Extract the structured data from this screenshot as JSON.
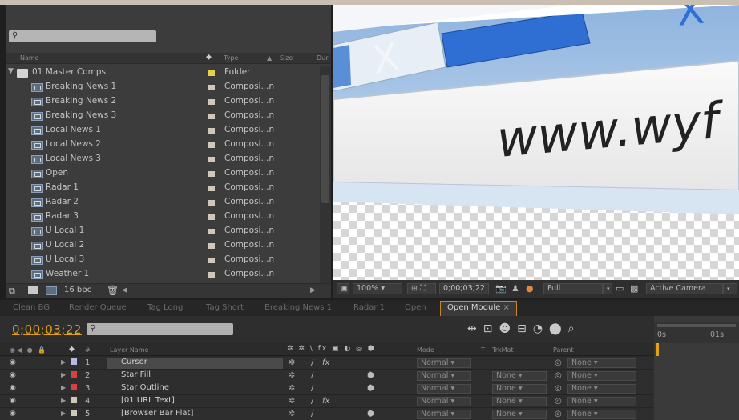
{
  "project": {
    "columns": {
      "name": "Name",
      "type": "Type",
      "size": "Size",
      "dur": "Dur"
    },
    "rows": [
      {
        "name": "01 Master Comps",
        "type": "Folder",
        "kind": "folder",
        "label_color": "#e2d24a"
      },
      {
        "name": "Breaking News 1",
        "type": "Composi...n",
        "kind": "comp",
        "label_color": "#cfc8b8"
      },
      {
        "name": "Breaking News 2",
        "type": "Composi...n",
        "kind": "comp",
        "label_color": "#cfc8b8"
      },
      {
        "name": "Breaking News 3",
        "type": "Composi...n",
        "kind": "comp",
        "label_color": "#cfc8b8"
      },
      {
        "name": "Local News 1",
        "type": "Composi...n",
        "kind": "comp",
        "label_color": "#cfc8b8"
      },
      {
        "name": "Local News 2",
        "type": "Composi...n",
        "kind": "comp",
        "label_color": "#cfc8b8"
      },
      {
        "name": "Local News 3",
        "type": "Composi...n",
        "kind": "comp",
        "label_color": "#cfc8b8"
      },
      {
        "name": "Open",
        "type": "Composi...n",
        "kind": "comp",
        "label_color": "#cfc8b8"
      },
      {
        "name": "Radar 1",
        "type": "Composi...n",
        "kind": "comp",
        "label_color": "#cfc8b8"
      },
      {
        "name": "Radar 2",
        "type": "Composi...n",
        "kind": "comp",
        "label_color": "#cfc8b8"
      },
      {
        "name": "Radar 3",
        "type": "Composi...n",
        "kind": "comp",
        "label_color": "#cfc8b8"
      },
      {
        "name": "U Local 1",
        "type": "Composi...n",
        "kind": "comp",
        "label_color": "#cfc8b8"
      },
      {
        "name": "U Local 2",
        "type": "Composi...n",
        "kind": "comp",
        "label_color": "#cfc8b8"
      },
      {
        "name": "U Local 3",
        "type": "Composi...n",
        "kind": "comp",
        "label_color": "#cfc8b8"
      },
      {
        "name": "Weather 1",
        "type": "Composi...n",
        "kind": "comp",
        "label_color": "#cfc8b8"
      }
    ],
    "bpc": "16 bpc"
  },
  "viewer": {
    "url_text": "www.wyf",
    "x_text": "X",
    "zoom": "100%",
    "timecode": "0;00;03;22",
    "resolution": "Full",
    "camera": "Active Camera"
  },
  "tabs": [
    {
      "label": "Clean BG",
      "active": false
    },
    {
      "label": "Render Queue",
      "active": false
    },
    {
      "label": "Tag Long",
      "active": false
    },
    {
      "label": "Tag Short",
      "active": false
    },
    {
      "label": "Breaking News 1",
      "active": false
    },
    {
      "label": "Radar 1",
      "active": false
    },
    {
      "label": "Open",
      "active": false
    },
    {
      "label": "Open Module",
      "active": true
    }
  ],
  "timeline": {
    "timecode": "0;00;03;22",
    "headers": {
      "layer_name": "Layer Name",
      "mode": "Mode",
      "t": "T",
      "trkmat": "TrkMat",
      "parent": "Parent"
    },
    "ruler": [
      "0s",
      "01s"
    ],
    "layers": [
      {
        "num": "1",
        "name": "Cursor",
        "color": "#b9b9e6",
        "mode": "Normal",
        "trkmat": "",
        "parent": "None",
        "fx": true,
        "selected": true
      },
      {
        "num": "2",
        "name": "Star Fill",
        "color": "#d94040",
        "mode": "Normal",
        "trkmat": "None",
        "parent": "None",
        "fx": false,
        "selected": false
      },
      {
        "num": "3",
        "name": "Star Outline",
        "color": "#d94040",
        "mode": "Normal",
        "trkmat": "None",
        "parent": "None",
        "fx": false,
        "selected": false
      },
      {
        "num": "4",
        "name": "[01 URL Text]",
        "color": "#cfc8b8",
        "mode": "Normal",
        "trkmat": "None",
        "parent": "None",
        "fx": true,
        "selected": false
      },
      {
        "num": "5",
        "name": "[Browser Bar Flat]",
        "color": "#cfc8b8",
        "mode": "Normal",
        "trkmat": "None",
        "parent": "None",
        "fx": false,
        "selected": false
      }
    ]
  }
}
